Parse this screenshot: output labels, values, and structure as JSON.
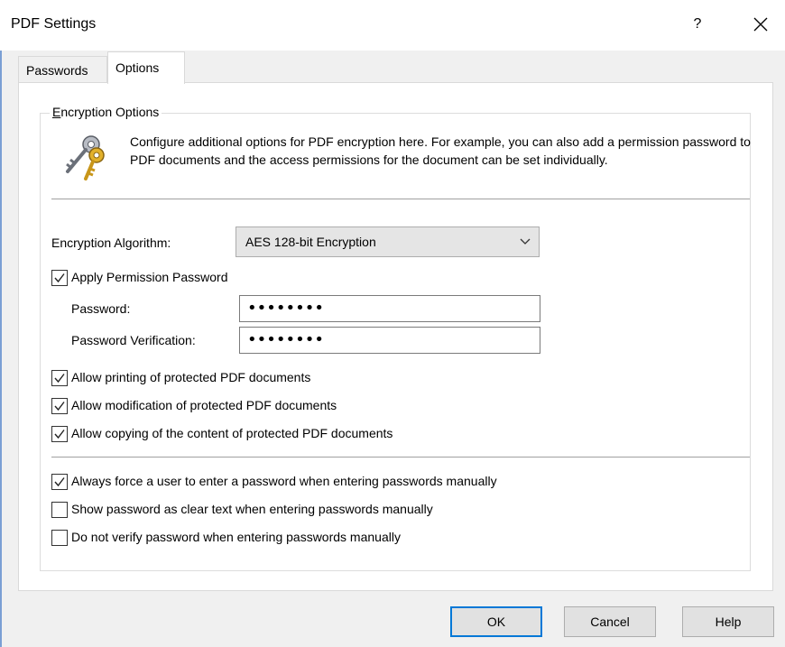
{
  "window": {
    "title": "PDF Settings",
    "help_label": "?",
    "close_label": "✕"
  },
  "tabs": [
    {
      "label": "Passwords",
      "active": false
    },
    {
      "label": "Options",
      "active": true
    }
  ],
  "encryption_options": {
    "group_title_prefix": "E",
    "group_title_rest": "ncryption Options",
    "description": "Configure additional options for PDF encryption here. For example, you can also add a permission password to PDF documents and the access permissions for the document can be set individually.",
    "icon": "keys-icon",
    "algorithm_label": "Encryption Algorithm:",
    "algorithm_value": "AES 128-bit Encryption",
    "apply_permission_password": {
      "label": "Apply Permission Password",
      "checked": true
    },
    "password_label": "Password:",
    "password_value": "••••••••",
    "password_verification_label": "Password Verification:",
    "password_verification_value": "••••••••",
    "permissions": [
      {
        "label": "Allow printing of protected PDF documents",
        "checked": true
      },
      {
        "label": "Allow modification of protected PDF documents",
        "checked": true
      },
      {
        "label": "Allow copying of the content of protected PDF documents",
        "checked": true
      }
    ],
    "manual_entry_options": [
      {
        "label": "Always force a user to enter a password when entering passwords manually",
        "checked": true
      },
      {
        "label": "Show password as clear text when entering passwords manually",
        "checked": false
      },
      {
        "label": "Do not verify password when entering passwords manually",
        "checked": false
      }
    ]
  },
  "buttons": {
    "ok": "OK",
    "cancel": "Cancel",
    "help": "Help"
  },
  "colors": {
    "accent": "#0078d7",
    "window_border": "#7a9fd4",
    "background": "#f0f0f0"
  }
}
